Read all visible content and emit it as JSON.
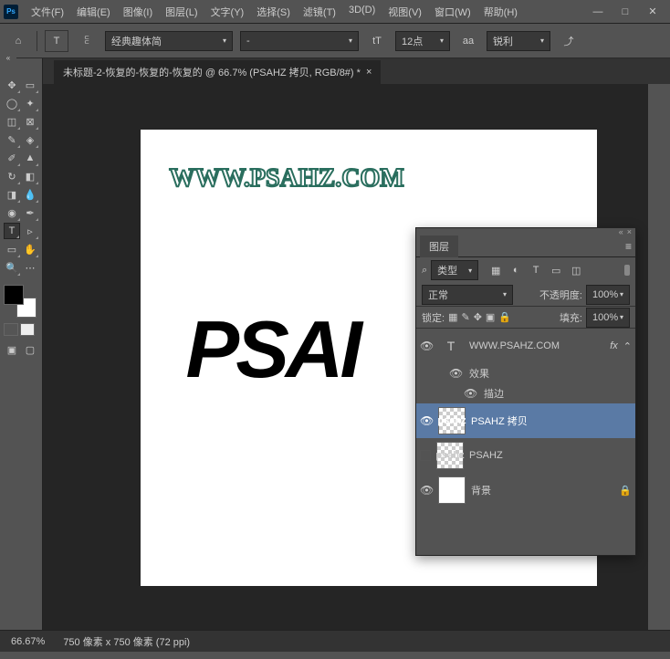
{
  "app_icon": "Ps",
  "menu": [
    "文件(F)",
    "编辑(E)",
    "图像(I)",
    "图层(L)",
    "文字(Y)",
    "选择(S)",
    "滤镜(T)",
    "3D(D)",
    "视图(V)",
    "窗口(W)",
    "帮助(H)"
  ],
  "window_buttons": {
    "min": "—",
    "max": "□",
    "close": "✕"
  },
  "options": {
    "font_family": "经典趣体简",
    "font_style": "-",
    "font_size": "12点",
    "aa": "aa",
    "aa_mode": "锐利"
  },
  "tab": {
    "title": "未标题-2-恢复的-恢复的-恢复的 @ 66.7% (PSAHZ 拷贝, RGB/8#) *",
    "close": "×"
  },
  "canvas": {
    "watermark": "WWW.PSAHZ.COM",
    "big": "PSAI"
  },
  "layers_panel": {
    "title": "图层",
    "filter_label": "类型",
    "blend_mode": "正常",
    "opacity_label": "不透明度:",
    "opacity_value": "100%",
    "lock_label": "锁定:",
    "fill_label": "填充:",
    "fill_value": "100%",
    "layers": [
      {
        "name": "WWW.PSAHZ.COM",
        "fx": "fx",
        "kind": "T"
      },
      {
        "name": "效果",
        "child": true
      },
      {
        "name": "描边",
        "child": true
      },
      {
        "name": "PSAHZ 拷贝",
        "thumb": "psahz",
        "selected": true
      },
      {
        "name": "PSAHZ",
        "thumb": "psahz",
        "hidden": true
      },
      {
        "name": "背景",
        "thumb": "white",
        "locked": true
      }
    ]
  },
  "statusbar": {
    "zoom": "66.67%",
    "dims": "750 像素 x 750 像素 (72 ppi)"
  }
}
